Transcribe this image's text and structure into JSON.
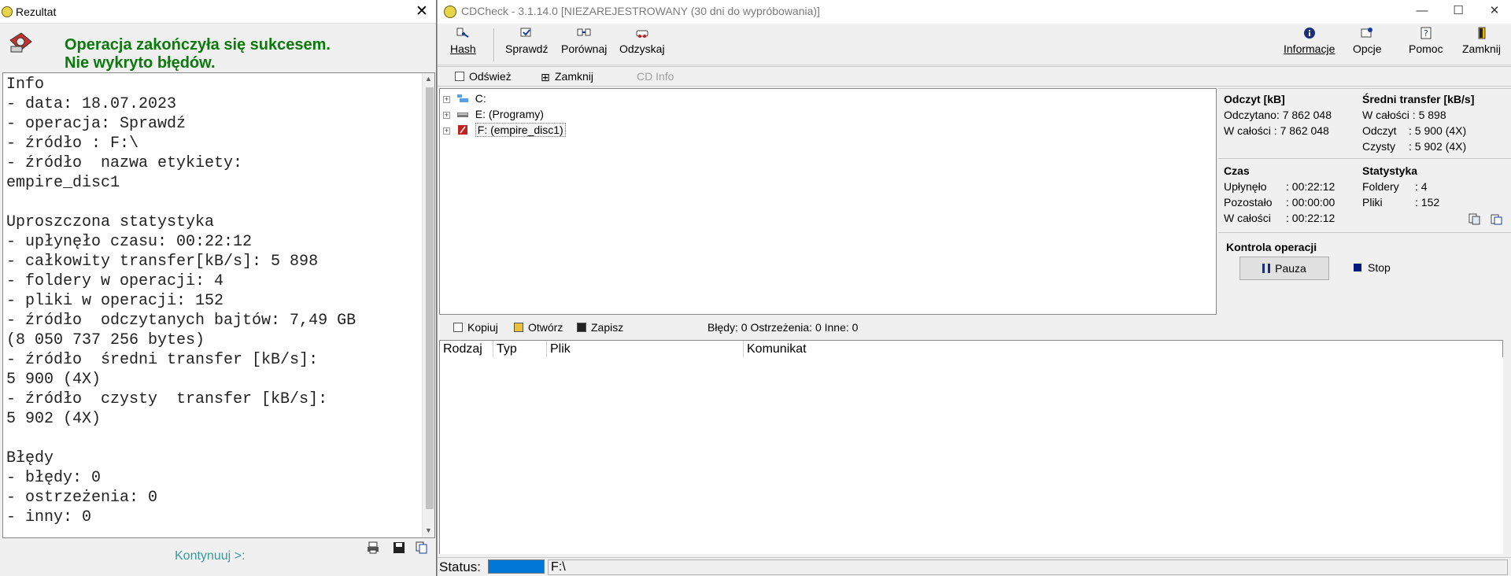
{
  "main_window": {
    "title": "CDCheck - 3.1.14.0 [NIEZAREJESTROWANY (30 dni do wypróbowania)]",
    "window_controls": {
      "minimize": "—",
      "maximize": "☐",
      "close": "✕"
    },
    "toolbar": {
      "hash": "Hash",
      "check": "Sprawdź",
      "compare": "Porównaj",
      "recover": "Odzyskaj",
      "info": "Informacje",
      "options": "Opcje",
      "help": "Pomoc",
      "close": "Zamknij"
    },
    "subbar": {
      "refresh": "Odśwież",
      "close": "Zamknij",
      "cd_info": "CD Info"
    },
    "tree": [
      {
        "label": "C:",
        "icon": "network-drive-icon"
      },
      {
        "label": "E: (Programy)",
        "icon": "hard-drive-icon"
      },
      {
        "label": "F: (empire_disc1)",
        "icon": "disc-drive-icon"
      }
    ],
    "stats": {
      "read_header": "Odczyt [kB]",
      "read_done": "Odczytano: 7 862 048",
      "read_total": "W całości  : 7 862 048",
      "avg_header": "Średni transfer [kB/s]",
      "avg_total": "W całości : 5 898",
      "avg_read_label": "Odczyt",
      "avg_read_value": ": 5 900 (4X)",
      "avg_clean_label": "Czysty",
      "avg_clean_value": ": 5 902 (4X)",
      "time_header": "Czas",
      "elapsed_label": "Upłynęło",
      "elapsed_value": ": 00:22:12",
      "remaining_label": "Pozostało",
      "remaining_value": ": 00:00:00",
      "time_total_label": "W całości",
      "time_total_value": ": 00:22:12",
      "statistics_header": "Statystyka",
      "folders_label": "Foldery",
      "folders_value": ": 4",
      "files_label": "Pliki",
      "files_value": ": 152",
      "control_header": "Kontrola operacji",
      "pause": "Pauza",
      "stop": "Stop"
    },
    "bottombar": {
      "copy": "Kopiuj",
      "open": "Otwórz",
      "save": "Zapisz",
      "summary": "Błędy: 0 Ostrzeżenia: 0 Inne: 0"
    },
    "log_columns": [
      "Rodzaj",
      "Typ",
      "Plik",
      "Komunikat"
    ],
    "status": {
      "label": "Status:",
      "progress": 1.0,
      "path": "F:\\"
    }
  },
  "result_dialog": {
    "title": "Rezultat",
    "close": "✕",
    "message_line1": "Operacja zakończyła się sukcesem.",
    "message_line2": "Nie wykryto błędów.",
    "report_lines": [
      "Info",
      "- data: 18.07.2023",
      "- operacja: Sprawdź",
      "- źródło : F:\\",
      "- źródło  nazwa etykiety:",
      "empire_disc1",
      "",
      "Uproszczona statystyka",
      "- upłynęło czasu: 00:22:12",
      "- całkowity transfer[kB/s]: 5 898",
      "- foldery w operacji: 4",
      "- pliki w operacji: 152",
      "- źródło  odczytanych bajtów: 7,49 GB",
      "(8 050 737 256 bytes)",
      "- źródło  średni transfer [kB/s]:",
      "5 900 (4X)",
      "- źródło  czysty  transfer [kB/s]:",
      "5 902 (4X)",
      "",
      "Błędy",
      "- błędy: 0",
      "- ostrzeżenia: 0",
      "- inny: 0"
    ],
    "continue": "Kontynuuj >:"
  },
  "colors": {
    "success_green": "#0a7a0a",
    "progress_blue": "#0078d7",
    "stop_navy": "#0a1a7a"
  }
}
